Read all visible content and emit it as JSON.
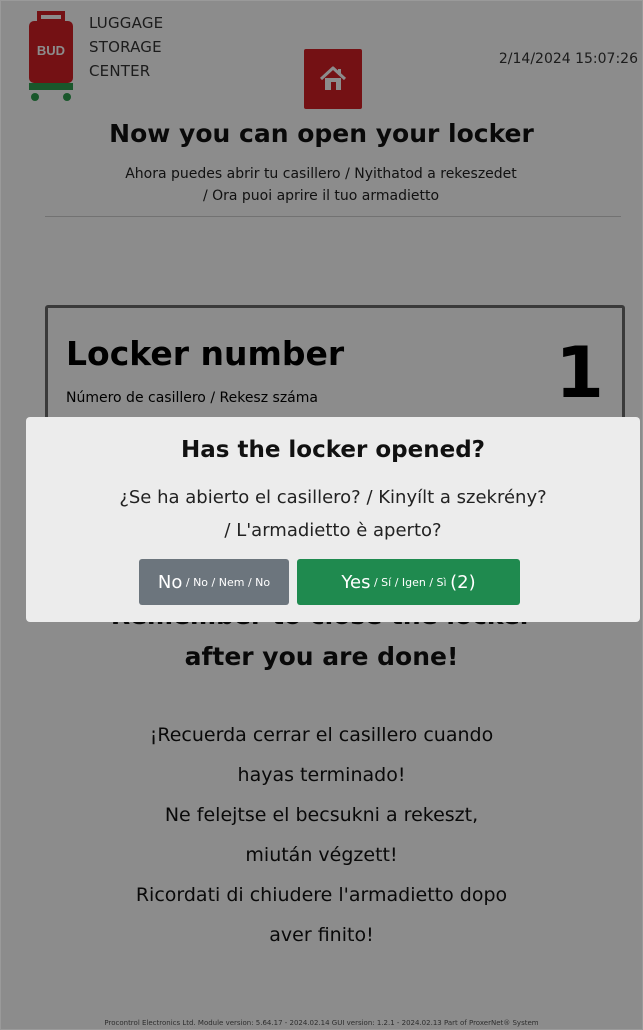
{
  "header": {
    "center_name": [
      "LUGGAGE",
      "STORAGE",
      "CENTER"
    ],
    "logo_text": "BUD",
    "datetime": "2/14/2024 15:07:26",
    "home_icon": "home-icon"
  },
  "main": {
    "title": "Now you can open your locker",
    "subtitle": [
      "Ahora puedes abrir tu casillero / Nyithatod a rekeszedet",
      "/ Ora puoi aprire il tuo armadietto"
    ],
    "locker": {
      "title": "Locker number",
      "subtitle": "Número de casillero / Rekesz száma",
      "number": "1"
    },
    "remember_title": [
      "Remember to close the locker",
      "after you are done!"
    ],
    "remember_sub": [
      "¡Recuerda cerrar el casillero cuando",
      "hayas terminado!",
      "Ne felejtse el becsukni a rekeszt,",
      "miután végzett!",
      "Ricordati di chiudere l'armadietto dopo",
      "aver finito!"
    ]
  },
  "modal": {
    "title": "Has the locker opened?",
    "subtitle": [
      "¿Se ha abierto el casillero?  / Kinyílt a szekrény?",
      "/ L'armadietto è aperto?"
    ],
    "no_button": {
      "main": "No",
      "translations": " / No / Nem / No"
    },
    "yes_button": {
      "main": "Yes",
      "translations": " / Sí / Igen / Sì ",
      "countdown": "(2)"
    }
  },
  "footer": "Procontrol Electronics Ltd.  Module version: 5.64.17 - 2024.02.14 GUI version: 1.2.1 - 2024.02.13  Part of ProxerNet® System",
  "colors": {
    "brand_red": "#d31f26",
    "yes_green": "#1f8a4f",
    "no_gray": "#6c757d",
    "overlay": "rgba(0,0,0,0.45)"
  }
}
